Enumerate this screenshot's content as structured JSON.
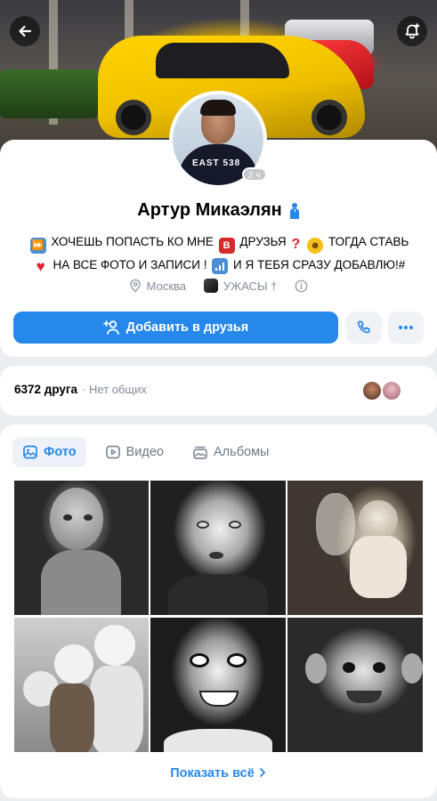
{
  "profile": {
    "name": "Артур Микаэлян",
    "online_badge": "2 ч",
    "shirt_text": "EAST 538",
    "status_line1_a": "ХОЧЕШЬ ПОПАСТЬ КО МНЕ",
    "status_line1_b": "ДРУЗЬЯ",
    "status_line1_c": "ТОГДА СТАВЬ",
    "status_line2_a": "НА ВСЕ ФОТО И ЗАПИСИ !",
    "status_line2_b": "И Я ТЕБЯ СРАЗУ ДОБАВЛЮ!#",
    "city": "Москва",
    "community": "УЖАСЫ †"
  },
  "actions": {
    "add_friend_label": "Добавить в друзья"
  },
  "friends": {
    "count_label": "6372 друга",
    "mutual_label": "· Нет общих"
  },
  "media": {
    "tabs": [
      {
        "label": "Фото",
        "icon": "image-icon",
        "active": true
      },
      {
        "label": "Видео",
        "icon": "video-icon",
        "active": false
      },
      {
        "label": "Альбомы",
        "icon": "albums-icon",
        "active": false
      }
    ],
    "show_all_label": "Показать всё"
  },
  "colors": {
    "accent": "#2688eb",
    "secondary_text": "#818c99",
    "background": "#ebedf0"
  }
}
